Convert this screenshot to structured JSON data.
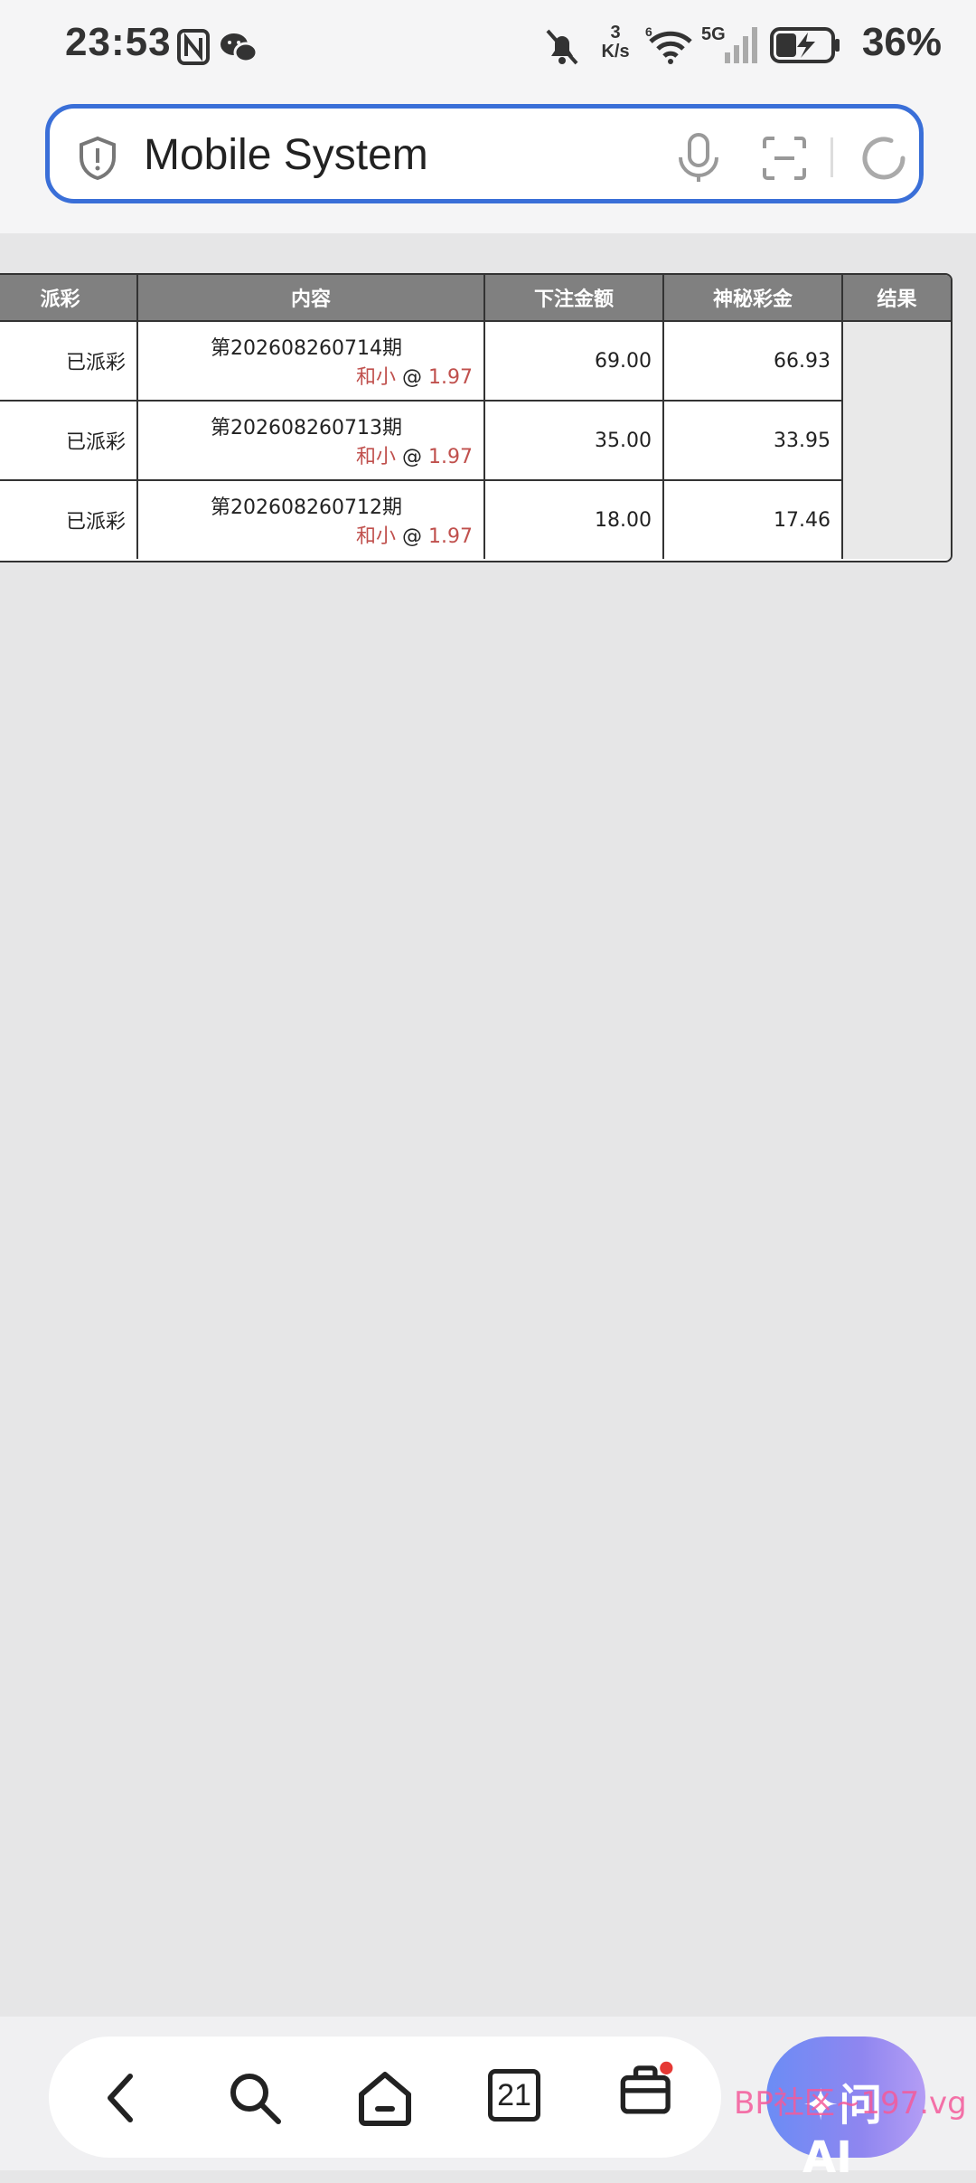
{
  "status_bar": {
    "time": "23:53",
    "net_speed_value": "3",
    "net_speed_unit": "K/s",
    "wifi_label": "6",
    "cell_label": "5G",
    "battery": "36%"
  },
  "browser": {
    "url_title": "Mobile System"
  },
  "table": {
    "headers": [
      "派彩",
      "内容",
      "下注金额",
      "神秘彩金",
      "结果"
    ],
    "rows": [
      {
        "payout": "已派彩",
        "issue": "第202608260714期",
        "bet": "和小",
        "at": "@",
        "odds": "1.97",
        "amount": "69.00",
        "bonus": "66.93"
      },
      {
        "payout": "已派彩",
        "issue": "第202608260713期",
        "bet": "和小",
        "at": "@",
        "odds": "1.97",
        "amount": "35.00",
        "bonus": "33.95"
      },
      {
        "payout": "已派彩",
        "issue": "第202608260712期",
        "bet": "和小",
        "at": "@",
        "odds": "1.97",
        "amount": "18.00",
        "bonus": "17.46"
      }
    ]
  },
  "bottom_nav": {
    "tabs_count": "21",
    "ai_label": "✦问 AI",
    "watermark": "BP社区~197.vg"
  },
  "colors": {
    "accent_blue": "#3a6fd8",
    "header_gray": "#808080",
    "odds_red": "#c0504d",
    "notification_dot": "#e53935"
  }
}
